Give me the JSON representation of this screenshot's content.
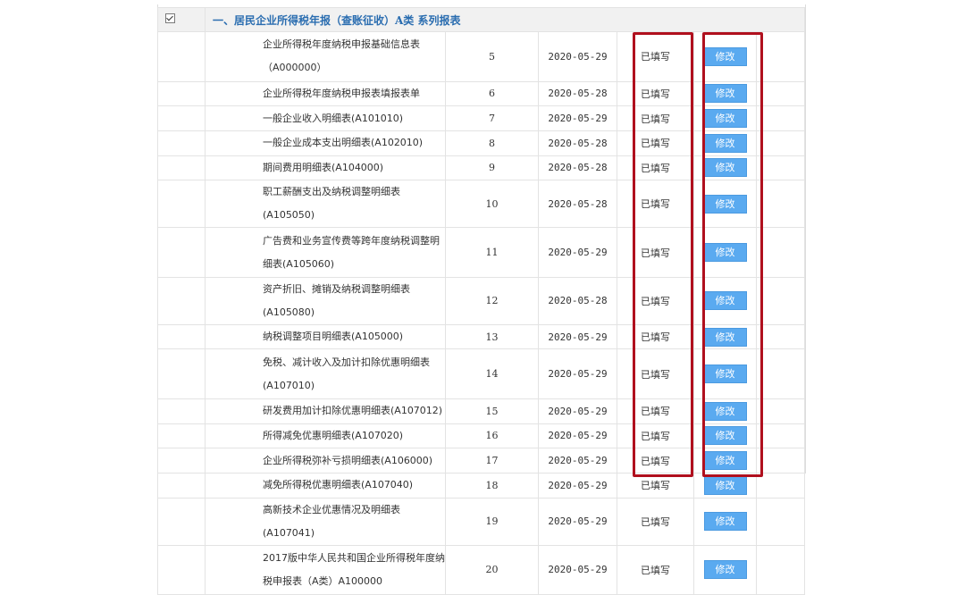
{
  "section": {
    "title": "一、居民企业所得税年报（查账征收）A类 系列报表"
  },
  "rows": [
    {
      "name": "企业所得税年度纳税申报基础信息表（A000000）",
      "seq": "5",
      "date": "2020-05-29",
      "status": "已填写",
      "action": "修改"
    },
    {
      "name": "企业所得税年度纳税申报表填报表单",
      "seq": "6",
      "date": "2020-05-28",
      "status": "已填写",
      "action": "修改"
    },
    {
      "name": "一般企业收入明细表(A101010)",
      "seq": "7",
      "date": "2020-05-29",
      "status": "已填写",
      "action": "修改"
    },
    {
      "name": "一般企业成本支出明细表(A102010)",
      "seq": "8",
      "date": "2020-05-28",
      "status": "已填写",
      "action": "修改"
    },
    {
      "name": "期间费用明细表(A104000)",
      "seq": "9",
      "date": "2020-05-28",
      "status": "已填写",
      "action": "修改"
    },
    {
      "name": "职工薪酬支出及纳税调整明细表(A105050)",
      "seq": "10",
      "date": "2020-05-28",
      "status": "已填写",
      "action": "修改"
    },
    {
      "name": "广告费和业务宣传费等跨年度纳税调整明细表(A105060)",
      "seq": "11",
      "date": "2020-05-29",
      "status": "已填写",
      "action": "修改"
    },
    {
      "name": "资产折旧、摊销及纳税调整明细表(A105080)",
      "seq": "12",
      "date": "2020-05-28",
      "status": "已填写",
      "action": "修改"
    },
    {
      "name": "纳税调整项目明细表(A105000)",
      "seq": "13",
      "date": "2020-05-29",
      "status": "已填写",
      "action": "修改"
    },
    {
      "name": "免税、减计收入及加计扣除优惠明细表(A107010)",
      "seq": "14",
      "date": "2020-05-29",
      "status": "已填写",
      "action": "修改"
    },
    {
      "name": "研发费用加计扣除优惠明细表(A107012)",
      "seq": "15",
      "date": "2020-05-29",
      "status": "已填写",
      "action": "修改"
    },
    {
      "name": "所得减免优惠明细表(A107020)",
      "seq": "16",
      "date": "2020-05-29",
      "status": "已填写",
      "action": "修改"
    },
    {
      "name": "企业所得税弥补亏损明细表(A106000)",
      "seq": "17",
      "date": "2020-05-29",
      "status": "已填写",
      "action": "修改"
    },
    {
      "name": "减免所得税优惠明细表(A107040)",
      "seq": "18",
      "date": "2020-05-29",
      "status": "已填写",
      "action": "修改"
    },
    {
      "name": "高新技术企业优惠情况及明细表(A107041)",
      "seq": "19",
      "date": "2020-05-29",
      "status": "已填写",
      "action": "修改"
    },
    {
      "name": "2017版中华人民共和国企业所得税年度纳税申报表（A类）A100000",
      "seq": "20",
      "date": "2020-05-29",
      "status": "已填写",
      "action": "修改"
    }
  ],
  "colors": {
    "highlight": "#b0101e",
    "button": "#5aaaf0",
    "title": "#2a6db0"
  }
}
